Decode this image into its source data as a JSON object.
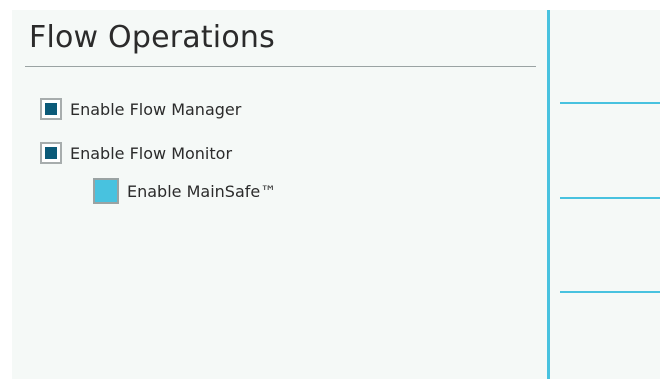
{
  "page": {
    "title": "Flow Operations"
  },
  "options": [
    {
      "label": "Enable Flow Manager",
      "checked": true
    },
    {
      "label": "Enable Flow Monitor",
      "checked": true
    },
    {
      "label": "Enable MainSafe™",
      "checked": false
    }
  ],
  "colors": {
    "accent": "#48c2df",
    "checked_fill": "#0b5a78",
    "panel_background": "#f5f9f7",
    "text": "#2b2b2b"
  }
}
